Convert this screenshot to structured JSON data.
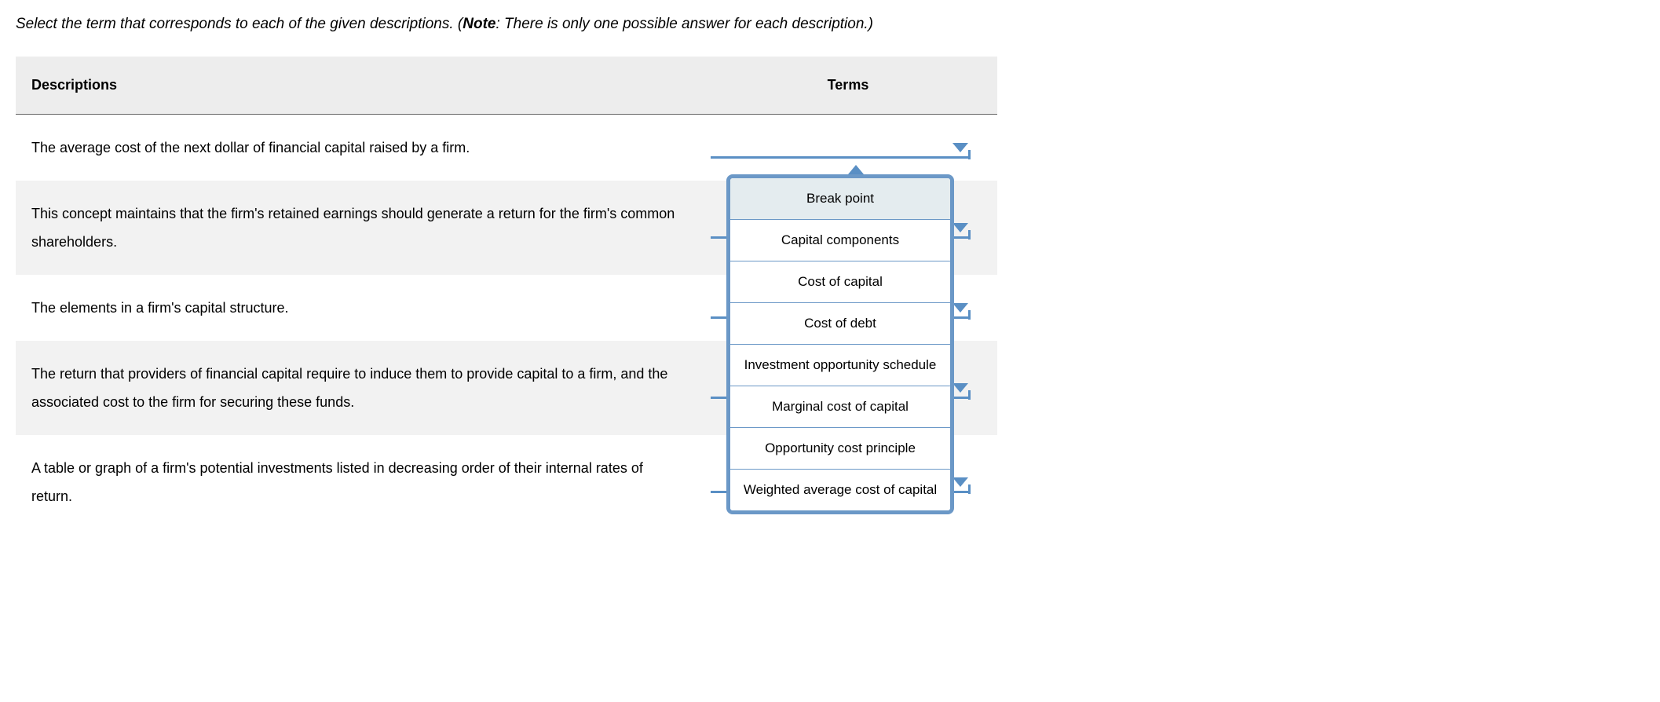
{
  "instruction": {
    "prefix": "Select the term that corresponds to each of the given descriptions. (",
    "note_label": "Note",
    "suffix": ": There is only one possible answer for each description.)"
  },
  "headers": {
    "descriptions": "Descriptions",
    "terms": "Terms"
  },
  "rows": [
    {
      "description": "The average cost of the next dollar of financial capital raised by a firm."
    },
    {
      "description": "This concept maintains that the firm's retained earnings should generate a return for the firm's common shareholders."
    },
    {
      "description": "The elements in a firm's capital structure."
    },
    {
      "description": "The return that providers of financial capital require to induce them to provide capital to a firm, and the associated cost to the firm for securing these funds."
    },
    {
      "description": "A table or graph of a firm's potential investments listed in decreasing order of their internal rates of return."
    }
  ],
  "dropdown": {
    "options": [
      "Break point",
      "Capital components",
      "Cost of capital",
      "Cost of debt",
      "Investment opportunity schedule",
      "Marginal cost of capital",
      "Opportunity cost principle",
      "Weighted average cost of capital"
    ],
    "highlighted_index": 0
  }
}
